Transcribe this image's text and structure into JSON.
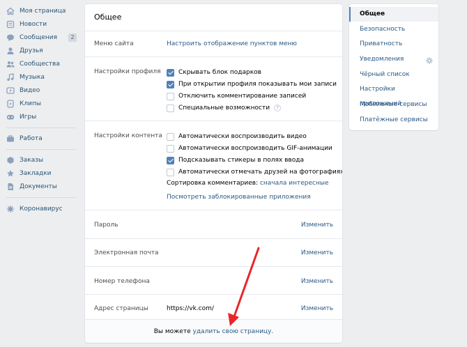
{
  "nav": {
    "items": [
      {
        "label": "Моя страница",
        "icon": "home-icon"
      },
      {
        "label": "Новости",
        "icon": "news-icon"
      },
      {
        "label": "Сообщения",
        "icon": "messages-icon",
        "badge": "2"
      },
      {
        "label": "Друзья",
        "icon": "friends-icon"
      },
      {
        "label": "Сообщества",
        "icon": "communities-icon"
      },
      {
        "label": "Музыка",
        "icon": "music-icon"
      },
      {
        "label": "Видео",
        "icon": "video-icon"
      },
      {
        "label": "Клипы",
        "icon": "clips-icon"
      },
      {
        "label": "Игры",
        "icon": "games-icon"
      },
      {
        "label": "Работа",
        "icon": "work-icon"
      },
      {
        "label": "Заказы",
        "icon": "orders-icon"
      },
      {
        "label": "Закладки",
        "icon": "bookmarks-icon"
      },
      {
        "label": "Документы",
        "icon": "documents-icon"
      },
      {
        "label": "Коронавирус",
        "icon": "coronavirus-icon"
      }
    ]
  },
  "settings": {
    "title": "Общее",
    "site_menu": {
      "label": "Меню сайта",
      "link": "Настроить отображение пунктов меню"
    },
    "profile": {
      "label": "Настройки профиля",
      "options": [
        {
          "text": "Скрывать блок подарков",
          "checked": true
        },
        {
          "text": "При открытии профиля показывать мои записи",
          "checked": true
        },
        {
          "text": "Отключить комментирование записей",
          "checked": false
        },
        {
          "text": "Специальные возможности",
          "checked": false,
          "help": "?"
        }
      ]
    },
    "content": {
      "label": "Настройки контента",
      "options": [
        {
          "text": "Автоматически воспроизводить видео",
          "checked": false
        },
        {
          "text": "Автоматически воспроизводить GIF-анимации",
          "checked": false
        },
        {
          "text": "Подсказывать стикеры в полях ввода",
          "checked": true
        },
        {
          "text": "Автоматически отмечать друзей на фотографиях",
          "checked": false
        }
      ],
      "sort_label": "Сортировка комментариев:",
      "sort_value": "сначала интересные",
      "blocked_apps": "Посмотреть заблокированные приложения"
    },
    "password": {
      "label": "Пароль",
      "action": "Изменить"
    },
    "email": {
      "label": "Электронная почта",
      "action": "Изменить"
    },
    "phone": {
      "label": "Номер телефона",
      "action": "Изменить"
    },
    "address": {
      "label": "Адрес страницы",
      "value": "https://vk.com/",
      "action": "Изменить"
    },
    "footer": {
      "prefix": "Вы можете",
      "link": "удалить свою страницу."
    }
  },
  "right_menu": {
    "items": [
      {
        "label": "Общее",
        "active": true
      },
      {
        "label": "Безопасность"
      },
      {
        "label": "Приватность"
      },
      {
        "label": "Уведомления",
        "icon": "gear-icon"
      },
      {
        "label": "Чёрный список"
      },
      {
        "label": "Настройки приложений"
      },
      {
        "label": "Мобильные сервисы"
      },
      {
        "label": "Платёжные сервисы"
      }
    ]
  },
  "colors": {
    "link": "#2a5885",
    "accent": "#5181b8",
    "arrow": "#e8262a",
    "background": "#edeef0"
  }
}
